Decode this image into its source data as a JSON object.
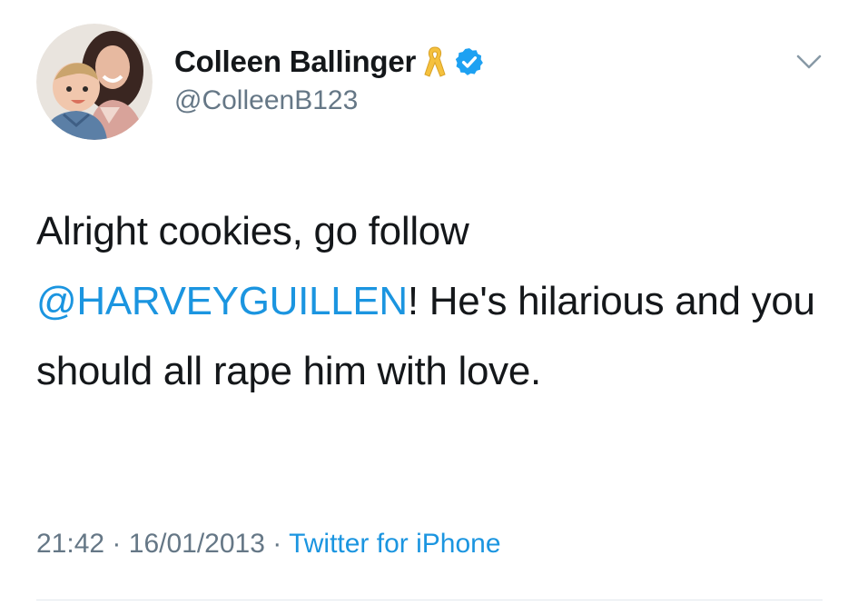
{
  "user": {
    "display_name": "Colleen Ballinger",
    "handle": "@ColleenB123",
    "verified": true,
    "ribbon_color": "#f5c13d"
  },
  "tweet": {
    "text_before": "Alright cookies, go follow ",
    "mention": "@HARVEYGUILLEN",
    "text_after": "! He's hilarious and you should all rape him with love.",
    "time": "21:42",
    "date": "16/01/2013",
    "separator": "·",
    "source": "Twitter for iPhone"
  },
  "icons": {
    "menu": "chevron-down-icon",
    "badge": "verified-badge-icon",
    "ribbon": "awareness-ribbon-icon"
  },
  "colors": {
    "text": "#14171a",
    "muted": "#657786",
    "link": "#1b95e0",
    "verified": "#1da1f2",
    "divider": "#e1e8ed"
  }
}
